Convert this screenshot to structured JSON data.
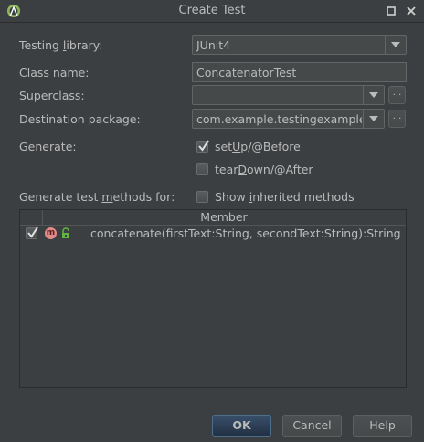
{
  "window": {
    "title": "Create Test",
    "app_icon": "android-studio-icon",
    "controls": [
      "restore-icon",
      "close-icon"
    ]
  },
  "form": {
    "testing_library": {
      "label_pre": "Testing ",
      "label_mnemonic": "l",
      "label_post": "ibrary:",
      "value": "JUnit4"
    },
    "class_name": {
      "label": "Class name:",
      "value": "ConcatenatorTest"
    },
    "superclass": {
      "label": "Superclass:",
      "value": "",
      "browse": "..."
    },
    "destination_package": {
      "label": "Destination package:",
      "value": "com.example.testingexample",
      "browse": "..."
    },
    "generate": {
      "label": "Generate:",
      "setup": {
        "pre": "set",
        "mnemonic": "U",
        "post": "p/@Before",
        "checked": true
      },
      "teardown": {
        "pre": "tear",
        "mnemonic": "D",
        "post": "own/@After",
        "checked": false
      }
    },
    "methods_for": {
      "pre": "Generate test ",
      "mnemonic": "m",
      "post": "ethods for:"
    },
    "show_inherited": {
      "pre": "Show ",
      "mnemonic": "i",
      "post": "nherited methods",
      "checked": false
    }
  },
  "members_table": {
    "header": "Member",
    "rows": [
      {
        "checked": true,
        "icon": "method-icon",
        "icon_letter": "m",
        "visibility_icon": "public-lock-icon",
        "text": "concatenate(firstText:String, secondText:String):String"
      }
    ]
  },
  "buttons": {
    "ok": "OK",
    "cancel": "Cancel",
    "help": "Help"
  },
  "colors": {
    "background": "#3c3f41",
    "field": "#45494a",
    "default_button": "#384f6b",
    "method_icon": "#e08a8a",
    "lock_icon": "#62b543"
  }
}
